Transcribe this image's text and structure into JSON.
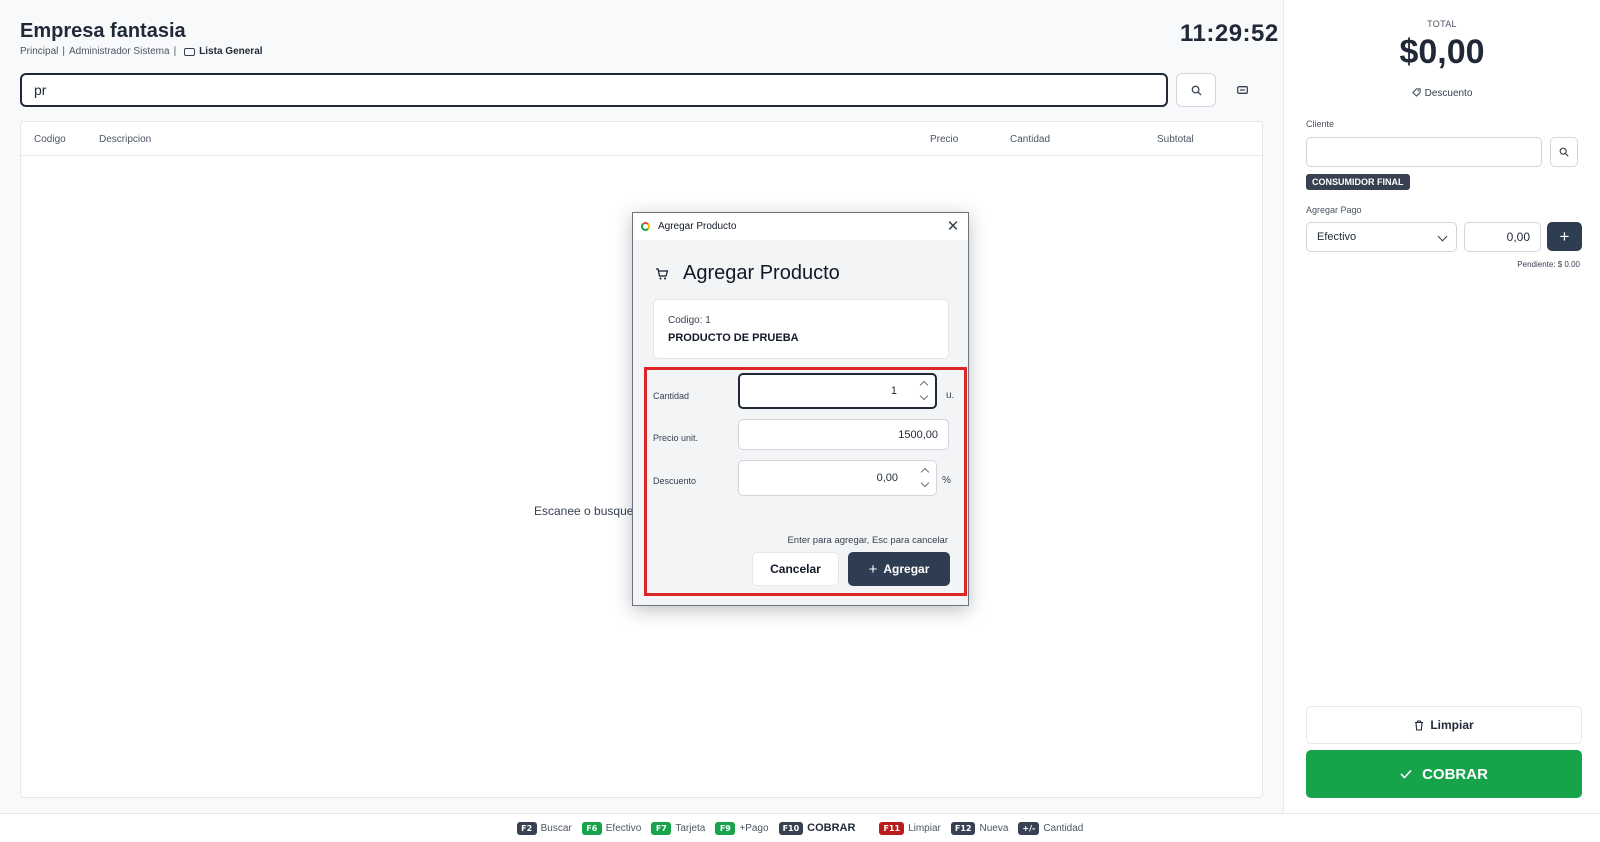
{
  "header": {
    "company": "Empresa fantasia",
    "branch": "Principal",
    "separator": "|",
    "user": "Administrador Sistema",
    "user_separator": "|",
    "price_list": "Lista General",
    "clock": "11:29:52"
  },
  "search": {
    "value": "pr"
  },
  "table": {
    "columns": [
      "Codigo",
      "Descripcion",
      "Precio",
      "Cantidad",
      "Subtotal"
    ],
    "empty_message": "Escanee o busque p"
  },
  "sidebar": {
    "total_label": "TOTAL",
    "total_value": "$0,00",
    "discount_link": "Descuento",
    "client_label": "Cliente",
    "client_value": "",
    "client_badge": "CONSUMIDOR FINAL",
    "payment_label": "Agregar Pago",
    "payment_method": "Efectivo",
    "payment_amount": "0,00",
    "add_payment": "+",
    "pending": "Pendiente: $ 0.00",
    "clear_button": "Limpiar",
    "charge_button": "COBRAR"
  },
  "footer": {
    "shortcuts": [
      {
        "key": "F2",
        "label": "Buscar",
        "color": "#374151"
      },
      {
        "key": "F6",
        "label": "Efectivo",
        "color": "#16a34a"
      },
      {
        "key": "F7",
        "label": "Tarjeta",
        "color": "#16a34a"
      },
      {
        "key": "F9",
        "label": "+Pago",
        "color": "#16a34a"
      },
      {
        "key": "F10",
        "label": "COBRAR",
        "color": "#374151"
      },
      {
        "key": "F11",
        "label": "Limpiar",
        "color": "#b91c1c"
      },
      {
        "key": "F12",
        "label": "Nueva",
        "color": "#374151"
      },
      {
        "key": "+/-",
        "label": "Cantidad",
        "color": "#374151"
      }
    ]
  },
  "modal": {
    "window_title": "Agregar Producto",
    "close": "✕",
    "heading": "Agregar Producto",
    "product_code": "Codigo: 1",
    "product_name": "PRODUCTO DE PRUEBA",
    "quantity_label": "Cantidad",
    "quantity_value": "1",
    "quantity_unit": "u.",
    "price_label": "Precio unit.",
    "price_value": "1500,00",
    "discount_label": "Descuento",
    "discount_value": "0,00",
    "discount_unit": "%",
    "hint": "Enter para agregar, Esc para cancelar",
    "cancel_button": "Cancelar",
    "add_button": "Agregar",
    "add_icon": "+"
  },
  "colors": {
    "primary_dark": "#2f3d52",
    "success": "#16a34a",
    "danger": "#dc2626",
    "highlight_border": "#dc2626"
  }
}
